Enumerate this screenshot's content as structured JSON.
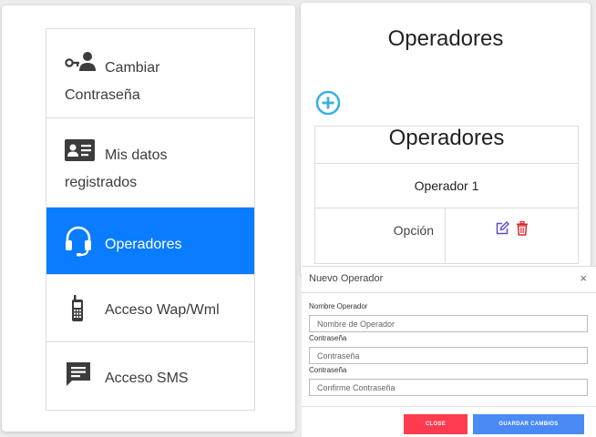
{
  "sidebar": {
    "items": [
      {
        "label": "Cambiar Contraseña",
        "icon": "key-user-icon"
      },
      {
        "label": "Mis datos registrados",
        "icon": "id-card-icon"
      },
      {
        "label": "Operadores",
        "icon": "headset-icon",
        "active": true
      },
      {
        "label": "Acceso Wap/Wml",
        "icon": "mobile-phone-icon"
      },
      {
        "label": "Acceso SMS",
        "icon": "message-icon"
      }
    ],
    "active_color": "#0a7cff"
  },
  "main": {
    "title": "Operadores",
    "add_icon": "add-circle-icon",
    "table": {
      "header": "Operadores",
      "operator": "Operador 1",
      "option_label": "Opción",
      "edit_icon": "edit-icon",
      "delete_icon": "delete-icon"
    }
  },
  "modal": {
    "title": "Nuevo Operador",
    "close_symbol": "×",
    "fields": [
      {
        "label": "Nombre Operador",
        "placeholder": "Nombre de Operador"
      },
      {
        "label": "Contraseña",
        "placeholder": "Contraseña"
      },
      {
        "label": "Contraseña",
        "placeholder": "Confirme Contraseña"
      }
    ],
    "close_button": "CLOSE",
    "save_button": "GUARDAR CAMBIOS"
  },
  "colors": {
    "accent": "#0a7cff",
    "add": "#3ab0e2",
    "edit": "#5a4fcf",
    "delete": "#e0262f",
    "close_button": "#ff3b4f",
    "save_button": "#4a8af4"
  }
}
